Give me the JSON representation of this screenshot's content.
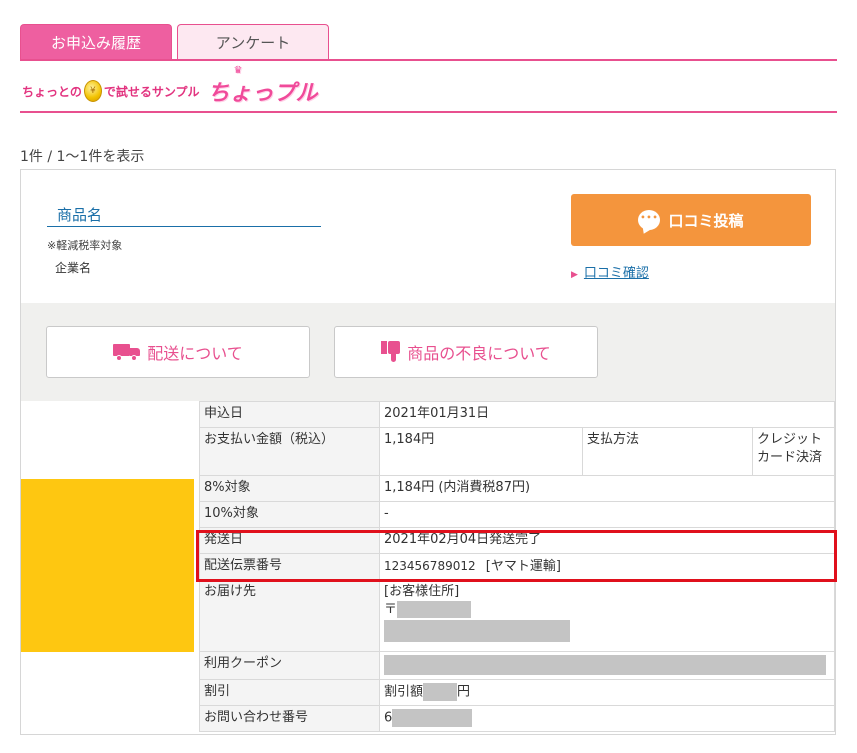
{
  "tabs": [
    {
      "label": "お申込み履歴",
      "active": true
    },
    {
      "label": "アンケート",
      "active": false
    }
  ],
  "logo": {
    "tagline_before": "ちょっとの",
    "coin_symbol": "¥",
    "tagline_after": "で試せるサンプル",
    "brand": "ちょっプル",
    "crown": "♛"
  },
  "result_count": "1件 / 1～1件を表示",
  "product": {
    "name": "商品名",
    "tax_note": "※軽減税率対象",
    "company": "企業名"
  },
  "review_button": {
    "label": "口コミ投稿",
    "icon_text": "•••"
  },
  "review_link": {
    "arrow": "▶",
    "label": "口コミ確認"
  },
  "help_buttons": {
    "delivery": "配送について",
    "defect": "商品の不良について"
  },
  "order_table": {
    "rows": [
      {
        "label": "申込日",
        "value": "2021年01月31日"
      },
      {
        "label": "お支払い金額（税込）",
        "value": "1,184円",
        "sub_label": "支払方法",
        "sub_value": "クレジットカード決済"
      },
      {
        "label": "8%対象",
        "value": "1,184円 (内消費税87円)"
      },
      {
        "label": "10%対象",
        "value": "-"
      },
      {
        "label": "発送日",
        "value": "2021年02月04日発送完了"
      },
      {
        "label": "配送伝票番号",
        "value": "123456789012",
        "carrier": "[ヤマト運輸]"
      },
      {
        "label": "お届け先",
        "value": "[お客様住所]",
        "postal_mark": "〒"
      },
      {
        "label": "利用クーポン",
        "value": ""
      },
      {
        "label": "割引",
        "value_prefix": "割引額",
        "value_suffix": "円"
      },
      {
        "label": "お問い合わせ番号",
        "value_prefix": "6"
      }
    ]
  },
  "colors": {
    "accent_pink": "#e8508f",
    "review_orange": "#f4953d",
    "highlight_red": "#e0101c",
    "redacted_yellow": "#fec711",
    "link_blue": "#1a6fa8"
  }
}
